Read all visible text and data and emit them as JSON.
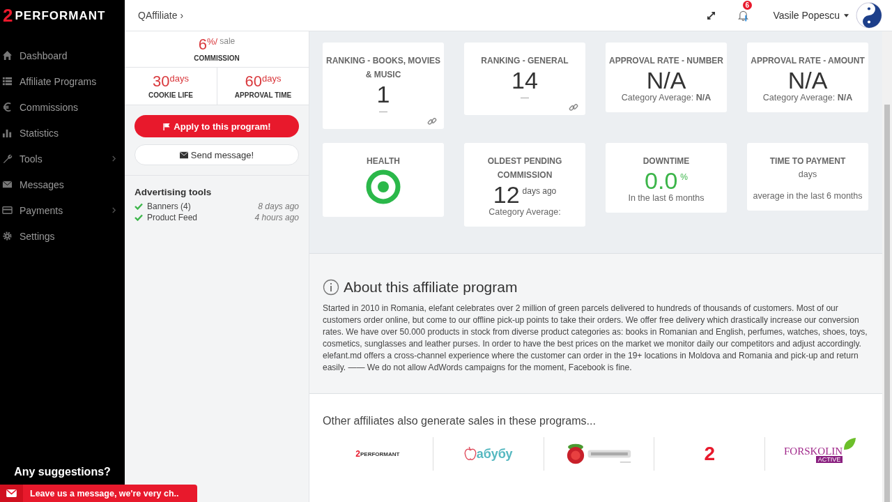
{
  "logo": {
    "mark": "2",
    "word": "PERFORMANT"
  },
  "nav": [
    {
      "label": "Dashboard",
      "submenu": false
    },
    {
      "label": "Affiliate Programs",
      "submenu": false
    },
    {
      "label": "Commissions",
      "submenu": false
    },
    {
      "label": "Statistics",
      "submenu": false
    },
    {
      "label": "Tools",
      "submenu": true
    },
    {
      "label": "Messages",
      "submenu": false
    },
    {
      "label": "Payments",
      "submenu": true
    },
    {
      "label": "Settings",
      "submenu": false
    }
  ],
  "suggest": {
    "title": "Any suggestions?"
  },
  "chat": {
    "text": "Leave us a message, we're very ch.."
  },
  "breadcrumb": "QAffiliate ›",
  "header": {
    "notifications": "6",
    "user": "Vasile Popescu"
  },
  "terms": {
    "commission": {
      "value": "6",
      "unit": "%/",
      "suffix": "sale",
      "label": "COMMISSION"
    },
    "cookie": {
      "value": "30",
      "unit": "days",
      "label": "COOKIE LIFE"
    },
    "approval": {
      "value": "60",
      "unit": "days",
      "label": "APPROVAL TIME"
    }
  },
  "apply_button": "Apply to this program!",
  "message_button": "Send message!",
  "advertising": {
    "title": "Advertising tools",
    "items": [
      {
        "label": "Banners (4)",
        "time": "8 days ago"
      },
      {
        "label": "Product Feed",
        "time": "4 hours ago"
      }
    ]
  },
  "stats": [
    {
      "kind": "ranking",
      "title": "RANKING - BOOKS, MOVIES & MUSIC",
      "value": "1",
      "note": "—"
    },
    {
      "kind": "ranking",
      "title": "RANKING - GENERAL",
      "value": "14",
      "note": "—"
    },
    {
      "kind": "rate",
      "title": "APPROVAL RATE - NUMBER",
      "value": "N/A",
      "note": "Category Average: **N/A**"
    },
    {
      "kind": "rate",
      "title": "APPROVAL RATE - AMOUNT",
      "value": "N/A",
      "note": "Category Average: **N/A**"
    },
    {
      "kind": "health",
      "title": "HEALTH"
    },
    {
      "kind": "pending",
      "title": "OLDEST PENDING COMMISSION",
      "value": "12",
      "unit": "days ago",
      "note": "Category Average:"
    },
    {
      "kind": "downtime",
      "title": "DOWNTIME",
      "value": "0.0",
      "unit": "%",
      "note": "In the last 6 months"
    },
    {
      "kind": "payment",
      "title": "TIME TO PAYMENT",
      "unit": "days",
      "note": "average in the last 6 months"
    }
  ],
  "about": {
    "title": "About this affiliate program",
    "text": "Started in 2010 in Romania, elefant celebrates over 2 million of green parcels delivered to hundreds of thousands of customers. Most of our customers order online, but come to our offline pick-up points to take their orders. We offer free delivery which drastically increase our conversion rates. We have over 50.000 products in stock from diverse product categories as: books in Romanian and English, perfumes, watches, shoes, toys, cosmetics, sunglasses and leather purses. In order to have the best prices on the market we monitor daily our competitors and adjust accordingly. elefant.md offers a cross-channel experience where the customer can order in the 19+ locations in Moldova and Romania and pick-up and return easily. —— We do not allow AdWords campaigns for the moment, Facebook is fine."
  },
  "others": {
    "title": "Other affiliates also generate sales in these programs...",
    "programs": [
      {
        "kind": "performant",
        "mark": "2",
        "word": "PERFORMANT"
      },
      {
        "kind": "abubu",
        "word": "абубу"
      },
      {
        "kind": "picture"
      },
      {
        "kind": "mark",
        "mark": "2"
      },
      {
        "kind": "forskolin",
        "word": "FORSKOLIN",
        "tag": "ACTIVE"
      }
    ]
  }
}
